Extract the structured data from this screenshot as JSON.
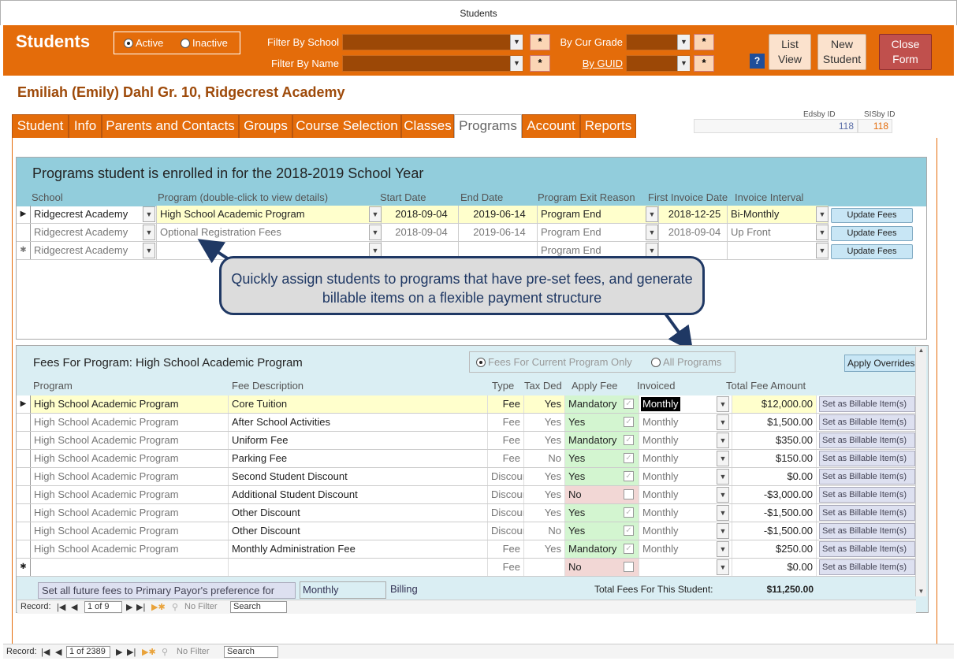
{
  "window_title": "Students",
  "header": {
    "title": "Students",
    "active_label": "Active",
    "inactive_label": "Inactive",
    "filter_school_label": "Filter By School",
    "filter_name_label": "Filter By Name",
    "by_cur_grade_label": "By Cur Grade",
    "by_guid_label": "By GUID",
    "star": "*",
    "help": "?",
    "list_view": "List View",
    "new_student": "New Student",
    "close_form": "Close Form"
  },
  "student": {
    "name": "Emiliah (Emily)  Dahl  Gr. 10, Ridgecrest Academy",
    "edsby_id_label": "Edsby ID",
    "edsby_id": "118",
    "sisby_id_label": "SISby ID",
    "sisby_id": "118"
  },
  "tabs": [
    "Student",
    "Info",
    "Parents and Contacts",
    "Groups",
    "Course Selection",
    "Classes",
    "Programs",
    "Account",
    "Reports"
  ],
  "programs": {
    "title": "Programs student is enrolled in for the 2018-2019 School Year",
    "columns": [
      "School",
      "Program (double-click to view details)",
      "Start Date",
      "End Date",
      "Program Exit Reason",
      "First Invoice Date",
      "Invoice Interval"
    ],
    "rows": [
      {
        "school": "Ridgecrest Academy",
        "program": "High School Academic Program",
        "start": "2018-09-04",
        "end": "2019-06-14",
        "exit": "Program End",
        "first_invoice": "2018-12-25",
        "interval": "Bi-Monthly",
        "button": "Update Fees"
      },
      {
        "school": "Ridgecrest Academy",
        "program": "Optional Registration Fees",
        "start": "2018-09-04",
        "end": "2019-06-14",
        "exit": "Program End",
        "first_invoice": "2018-09-04",
        "interval": "Up Front",
        "button": "Update Fees"
      },
      {
        "school": "Ridgecrest Academy",
        "program": "",
        "start": "",
        "end": "",
        "exit": "Program End",
        "first_invoice": "",
        "interval": "",
        "button": "Update Fees"
      }
    ]
  },
  "callout": "Quickly assign students to programs that have pre-set fees, and generate billable items on a flexible payment structure",
  "fees": {
    "title": "Fees For Program: High School Academic Program",
    "option_current": "Fees For Current Program Only",
    "option_all": "All Programs",
    "apply_overrides": "Apply Overrides",
    "columns": [
      "Program",
      "Fee Description",
      "Type",
      "Tax Ded",
      "Apply Fee",
      "Invoiced",
      "Total Fee Amount"
    ],
    "rows": [
      {
        "program": "High School Academic Program",
        "desc": "Core Tuition",
        "type": "Fee",
        "tax": "Yes",
        "apply": "Mandatory",
        "invoiced": "Monthly",
        "amount": "$12,000.00",
        "button": "Set as Billable Item(s)"
      },
      {
        "program": "High School Academic Program",
        "desc": "After School Activities",
        "type": "Fee",
        "tax": "Yes",
        "apply": "Yes",
        "invoiced": "Monthly",
        "amount": "$1,500.00",
        "button": "Set as Billable Item(s)"
      },
      {
        "program": "High School Academic Program",
        "desc": "Uniform Fee",
        "type": "Fee",
        "tax": "Yes",
        "apply": "Mandatory",
        "invoiced": "Monthly",
        "amount": "$350.00",
        "button": "Set as Billable Item(s)"
      },
      {
        "program": "High School Academic Program",
        "desc": "Parking Fee",
        "type": "Fee",
        "tax": "No",
        "apply": "Yes",
        "invoiced": "Monthly",
        "amount": "$150.00",
        "button": "Set as Billable Item(s)"
      },
      {
        "program": "High School Academic Program",
        "desc": "Second Student Discount",
        "type": "Discount",
        "tax": "Yes",
        "apply": "Yes",
        "invoiced": "Monthly",
        "amount": "$0.00",
        "button": "Set as Billable Item(s)"
      },
      {
        "program": "High School Academic Program",
        "desc": "Additional Student Discount",
        "type": "Discount",
        "tax": "Yes",
        "apply": "No",
        "invoiced": "Monthly",
        "amount": "-$3,000.00",
        "button": "Set as Billable Item(s)"
      },
      {
        "program": "High School Academic Program",
        "desc": "Other Discount",
        "type": "Discount",
        "tax": "Yes",
        "apply": "Yes",
        "invoiced": "Monthly",
        "amount": "-$1,500.00",
        "button": "Set as Billable Item(s)"
      },
      {
        "program": "High School Academic Program",
        "desc": "Other Discount",
        "type": "Discount",
        "tax": "No",
        "apply": "Yes",
        "invoiced": "Monthly",
        "amount": "-$1,500.00",
        "button": "Set as Billable Item(s)"
      },
      {
        "program": "High School Academic Program",
        "desc": "Monthly Administration Fee",
        "type": "Fee",
        "tax": "Yes",
        "apply": "Mandatory",
        "invoiced": "Monthly",
        "amount": "$250.00",
        "button": "Set as Billable Item(s)"
      },
      {
        "program": "",
        "desc": "",
        "type": "Fee",
        "tax": "",
        "apply": "No",
        "invoiced": "",
        "amount": "$0.00",
        "button": "Set as Billable Item(s)"
      }
    ],
    "set_future_label": "Set all future fees to Primary Payor's preference for",
    "future_value": "Monthly",
    "billing_label": "Billing",
    "total_label": "Total Fees For This Student:",
    "total_value": "$11,250.00"
  },
  "inner_nav": {
    "record_label": "Record:",
    "position": "1 of 9",
    "no_filter": "No Filter",
    "search": "Search"
  },
  "outer_nav": {
    "record_label": "Record:",
    "position": "1 of 2389",
    "no_filter": "No Filter",
    "search": "Search"
  }
}
